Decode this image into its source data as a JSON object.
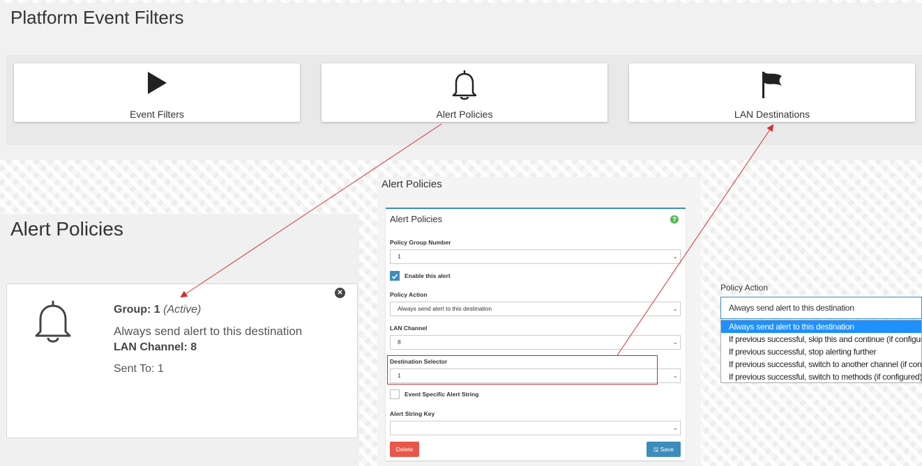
{
  "top": {
    "title": "Platform Event Filters",
    "cards": [
      {
        "label": "Event Filters",
        "icon": "play-icon"
      },
      {
        "label": "Alert Policies",
        "icon": "bell-icon"
      },
      {
        "label": "LAN Destinations",
        "icon": "flag-icon"
      }
    ]
  },
  "alert_policies_page": {
    "title": "Alert Policies",
    "card": {
      "group_label": "Group:",
      "group_value": "1",
      "group_status": "(Active)",
      "action": "Always send alert to this destination",
      "lan_channel": "LAN Channel: 8",
      "sent_to": "Sent To: 1",
      "close_icon": "close-circle-icon"
    }
  },
  "form": {
    "section_title": "Alert Policies",
    "panel_title": "Alert Policies",
    "policy_group_label": "Policy Group Number",
    "policy_group_value": "1",
    "enable_alert_label": "Enable this alert",
    "enable_alert_checked": true,
    "policy_action_label": "Policy Action",
    "policy_action_value": "Always send alert to this destination",
    "lan_channel_label": "LAN Channel",
    "lan_channel_value": "8",
    "destination_selector_label": "Destination Selector",
    "destination_selector_value": "1",
    "event_specific_label": "Event Specific Alert String",
    "event_specific_checked": false,
    "alert_string_key_label": "Alert String Key",
    "alert_string_key_value": "",
    "delete_label": "Delete",
    "save_label": "Save"
  },
  "policy_action_dropdown": {
    "label": "Policy Action",
    "selected": "Always send alert to this destination",
    "options": [
      "Always send alert to this destination",
      "If previous successful, skip this and continue (if configured)",
      "If previous successful, stop alerting further",
      "If previous successful, switch to another channel (if configured)",
      "If previous successful, switch to methods (if configured)"
    ]
  },
  "colors": {
    "accent": "#3c8dbc",
    "highlight": "#c62828",
    "delete": "#e8574b",
    "selected_option": "#1e90ff",
    "help": "#5cb85c"
  }
}
